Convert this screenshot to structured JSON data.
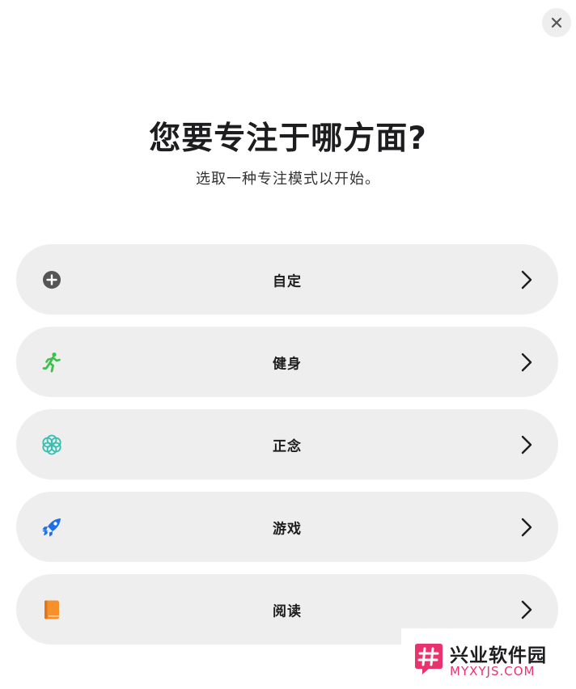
{
  "header": {
    "close_icon": "close-icon",
    "title": "您要专注于哪方面?",
    "subtitle": "选取一种专注模式以开始。"
  },
  "modes": [
    {
      "label": "自定",
      "icon": "plus-circle-icon",
      "icon_color": "#555555"
    },
    {
      "label": "健身",
      "icon": "running-figure-icon",
      "icon_color": "#3cc14a"
    },
    {
      "label": "正念",
      "icon": "flower-icon",
      "icon_color": "#35bfb0"
    },
    {
      "label": "游戏",
      "icon": "rocket-icon",
      "icon_color": "#1f6fe8"
    },
    {
      "label": "阅读",
      "icon": "book-icon",
      "icon_color": "#f5902a"
    }
  ],
  "watermark": {
    "name_cn": "兴业软件园",
    "domain": "MYXYJS.COM",
    "brand_color": "#e8336f"
  }
}
